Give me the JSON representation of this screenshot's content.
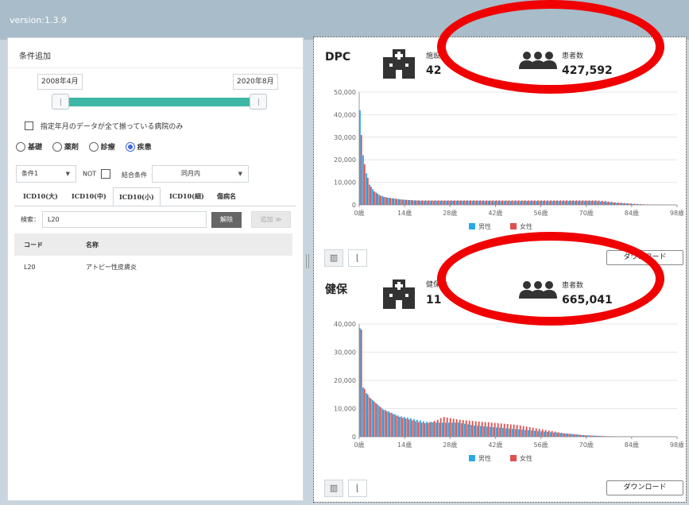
{
  "app": {
    "version": "version:1.3.9"
  },
  "left": {
    "title": "条件追加",
    "date_start": "2008年4月",
    "date_end": "2020年8月",
    "checkbox_label": "指定年月のデータが全て揃っている病院のみ",
    "radio_options": [
      {
        "label": "基礎",
        "selected": false
      },
      {
        "label": "薬剤",
        "selected": false
      },
      {
        "label": "診療",
        "selected": false
      },
      {
        "label": "疾患",
        "selected": true
      }
    ],
    "condition_select": "条件1",
    "not_label": "NOT",
    "combine_label": "結合条件",
    "combine_select": "同月内",
    "tabs": [
      "ICD10(大)",
      "ICD10(中)",
      "ICD10(小)",
      "ICD10(細)",
      "傷病名"
    ],
    "active_tab": 2,
    "search_label": "検索：",
    "search_value": "L20",
    "clear_label": "解除",
    "add_label": "追加 ≫",
    "table_headers": {
      "code": "コード",
      "name": "名称"
    },
    "table_rows": [
      {
        "code": "L20",
        "name": "アトピー性皮膚炎"
      }
    ]
  },
  "sections": [
    {
      "title": "DPC",
      "facility_label": "施設数",
      "facility_value": "42",
      "patient_label": "患者数",
      "patient_value": "427,592",
      "download_label": "ダウンロード",
      "legend": [
        "男性",
        "女性"
      ]
    },
    {
      "title": "健保",
      "facility_label": "健保数",
      "facility_value": "11",
      "patient_label": "患者数",
      "patient_value": "665,041",
      "download_label": "ダウンロード",
      "legend": [
        "男性",
        "女性"
      ]
    }
  ],
  "chart_data": [
    {
      "type": "bar",
      "xlabel": "",
      "ylabel": "",
      "ylim": [
        0,
        50000
      ],
      "y_ticks": [
        "50,000",
        "40,000",
        "30,000",
        "20,000",
        "10,000",
        "0"
      ],
      "x_ticks": [
        "0歳",
        "14歳",
        "28歳",
        "42歳",
        "56歳",
        "70歳",
        "84歳",
        "98歳"
      ],
      "colors": {
        "male": "#2aa8e6",
        "female": "#e05050"
      },
      "series": [
        {
          "name": "男性",
          "values": [
            42000,
            22000,
            14000,
            9000,
            7000,
            5500,
            4500,
            4000,
            3500,
            3200,
            3000,
            2800,
            2600,
            2400,
            2300,
            2200,
            2100,
            2000,
            1900,
            1800,
            1800,
            1800,
            1800,
            1800,
            1800,
            1800,
            1800,
            1800,
            1800,
            1800,
            1800,
            1800,
            1800,
            1800,
            1800,
            1800,
            1800,
            1800,
            1800,
            1700,
            1700,
            1700,
            1700,
            1700,
            1700,
            1700,
            1700,
            1700,
            1700,
            1700,
            1700,
            1700,
            1700,
            1700,
            1700,
            1700,
            1700,
            1700,
            1700,
            1700,
            1700,
            1700,
            1700,
            1700,
            1700,
            1700,
            1700,
            1700,
            1700,
            1700,
            1700,
            1700,
            1700,
            1700,
            1600,
            1500,
            1400,
            1300,
            1100,
            1000,
            900,
            800,
            700,
            600,
            500,
            400,
            300,
            250,
            200,
            150,
            120,
            100,
            80,
            60,
            40,
            30,
            20,
            10,
            5
          ]
        },
        {
          "name": "女性",
          "values": [
            31000,
            18000,
            12000,
            8000,
            6000,
            5000,
            4000,
            3500,
            3200,
            3000,
            2800,
            2600,
            2400,
            2300,
            2200,
            2100,
            2000,
            2000,
            2000,
            2000,
            2000,
            2000,
            2000,
            2000,
            2000,
            2000,
            2000,
            2000,
            2000,
            2000,
            2000,
            2000,
            2000,
            2000,
            2000,
            2000,
            2000,
            2000,
            2000,
            2000,
            2000,
            2000,
            2000,
            2000,
            2000,
            2000,
            2000,
            2000,
            2000,
            2000,
            2000,
            2000,
            2000,
            2000,
            2000,
            2000,
            2000,
            2000,
            2000,
            2000,
            2000,
            2000,
            2000,
            2000,
            2000,
            2000,
            2000,
            2000,
            2000,
            2000,
            2000,
            2000,
            2000,
            2000,
            1900,
            1800,
            1700,
            1500,
            1300,
            1100,
            1000,
            900,
            800,
            700,
            600,
            500,
            400,
            300,
            250,
            200,
            150,
            120,
            100,
            80,
            60,
            40,
            30,
            20,
            10
          ]
        }
      ]
    },
    {
      "type": "bar",
      "xlabel": "",
      "ylabel": "",
      "ylim": [
        0,
        40000
      ],
      "y_ticks": [
        "40,000",
        "30,000",
        "20,000",
        "10,000",
        "0"
      ],
      "x_ticks": [
        "0歳",
        "14歳",
        "28歳",
        "42歳",
        "56歳",
        "70歳",
        "84歳",
        "98歳"
      ],
      "colors": {
        "male": "#2aa8e6",
        "female": "#e05050"
      },
      "series": [
        {
          "name": "男性",
          "values": [
            38500,
            17500,
            15500,
            14000,
            13000,
            12000,
            11000,
            10000,
            9500,
            9000,
            8500,
            8000,
            7500,
            7200,
            7000,
            6800,
            6500,
            6200,
            6000,
            5800,
            5500,
            5300,
            5200,
            5100,
            5000,
            5000,
            5000,
            5000,
            5000,
            5000,
            5000,
            5000,
            4800,
            4600,
            4400,
            4200,
            4000,
            3900,
            3800,
            3700,
            3600,
            3500,
            3400,
            3300,
            3200,
            3100,
            3000,
            2900,
            2800,
            2700,
            2600,
            2500,
            2400,
            2300,
            2200,
            2100,
            2000,
            1900,
            1800,
            1700,
            1600,
            1500,
            1400,
            1300,
            1200,
            1100,
            1000,
            900,
            800,
            700,
            600,
            500,
            450,
            400,
            350,
            300,
            250,
            200,
            180,
            160,
            140,
            120,
            100,
            90,
            80,
            70,
            60,
            50,
            40,
            30,
            25,
            20,
            15,
            10,
            8,
            6,
            4,
            3,
            2,
            1
          ]
        },
        {
          "name": "女性",
          "values": [
            38000,
            17000,
            15000,
            13500,
            12500,
            11500,
            10500,
            9500,
            9000,
            8500,
            8000,
            7500,
            7000,
            6700,
            6400,
            6100,
            5800,
            5500,
            5200,
            5000,
            4800,
            4900,
            5200,
            5600,
            6000,
            6600,
            7000,
            6800,
            6600,
            6400,
            6200,
            6000,
            5900,
            5800,
            5700,
            5600,
            5500,
            5400,
            5300,
            5200,
            5100,
            5000,
            4900,
            4800,
            4700,
            4600,
            4500,
            4400,
            4300,
            4200,
            4000,
            3800,
            3600,
            3400,
            3200,
            3000,
            2800,
            2600,
            2400,
            2200,
            2000,
            1800,
            1600,
            1400,
            1200,
            1100,
            1000,
            900,
            800,
            700,
            600,
            500,
            450,
            400,
            350,
            300,
            250,
            200,
            180,
            160,
            140,
            120,
            100,
            90,
            80,
            70,
            60,
            50,
            40,
            30,
            25,
            20,
            15,
            10,
            8,
            6,
            4,
            3,
            2
          ]
        }
      ]
    }
  ]
}
